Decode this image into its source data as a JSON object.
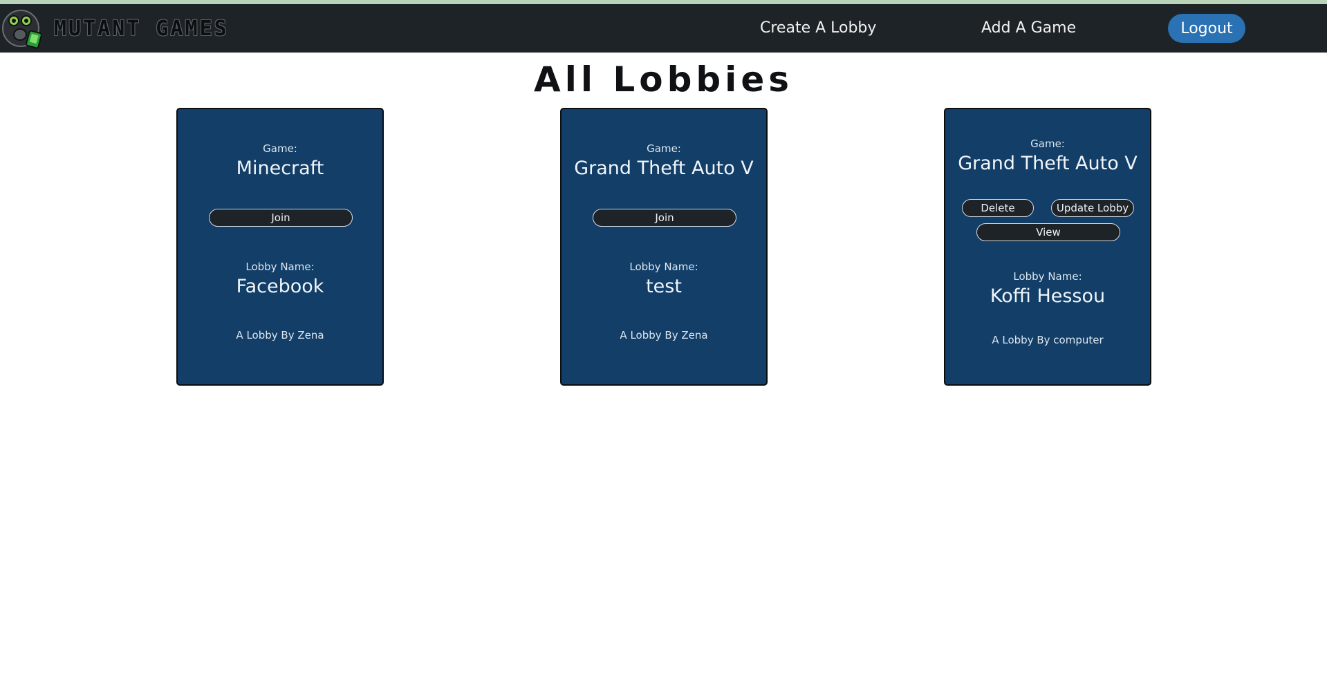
{
  "header": {
    "brand": "MUTANT GAMES",
    "logo_icon": "gas-mask-gamer-icon",
    "nav": {
      "create_lobby": "Create A Lobby",
      "add_game": "Add A Game",
      "logout": "Logout"
    }
  },
  "main": {
    "title": "All Lobbies",
    "lobbies": [
      {
        "game_label": "Game:",
        "game": "Minecraft",
        "join": "Join",
        "lobby_label": "Lobby Name:",
        "lobby_name": "Facebook",
        "owner": "A Lobby By Zena"
      },
      {
        "game_label": "Game:",
        "game": "Grand Theft Auto V",
        "join": "Join",
        "lobby_label": "Lobby Name:",
        "lobby_name": "test",
        "owner": "A Lobby By Zena"
      },
      {
        "game_label": "Game:",
        "game": "Grand Theft Auto V",
        "delete": "Delete",
        "update": "Update Lobby",
        "view": "View",
        "lobby_label": "Lobby Name:",
        "lobby_name": "Koffi Hessou",
        "owner": "A Lobby By computer"
      }
    ]
  },
  "colors": {
    "navbar": "#1e2328",
    "card": "#123e68",
    "logout": "#2a72b3",
    "button": "#1e2328"
  }
}
